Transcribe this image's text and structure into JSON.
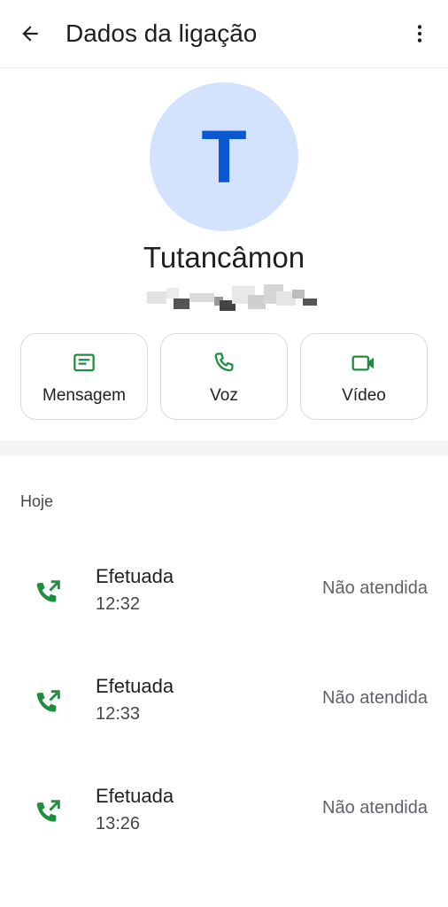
{
  "appbar": {
    "title": "Dados da ligação",
    "back_icon": "arrow-back-icon",
    "more_icon": "more-vert-icon"
  },
  "contact": {
    "avatar_letter": "T",
    "name": "Tutancâmon",
    "number": "",
    "avatar_bg": "#d3e3fd",
    "avatar_fg": "#0b57d0"
  },
  "actions": [
    {
      "label": "Mensagem",
      "icon": "message-icon"
    },
    {
      "label": "Voz",
      "icon": "phone-icon"
    },
    {
      "label": "Vídeo",
      "icon": "videocam-icon"
    }
  ],
  "history": {
    "section_label": "Hoje",
    "calls": [
      {
        "type": "Efetuada",
        "time": "12:32",
        "status": "Não atendida",
        "icon": "outgoing-call-icon"
      },
      {
        "type": "Efetuada",
        "time": "12:33",
        "status": "Não atendida",
        "icon": "outgoing-call-icon"
      },
      {
        "type": "Efetuada",
        "time": "13:26",
        "status": "Não atendida",
        "icon": "outgoing-call-icon"
      }
    ]
  },
  "colors": {
    "accent_green": "#1e8e3e",
    "text_primary": "#1f1f1f",
    "text_secondary": "#5f6368"
  }
}
